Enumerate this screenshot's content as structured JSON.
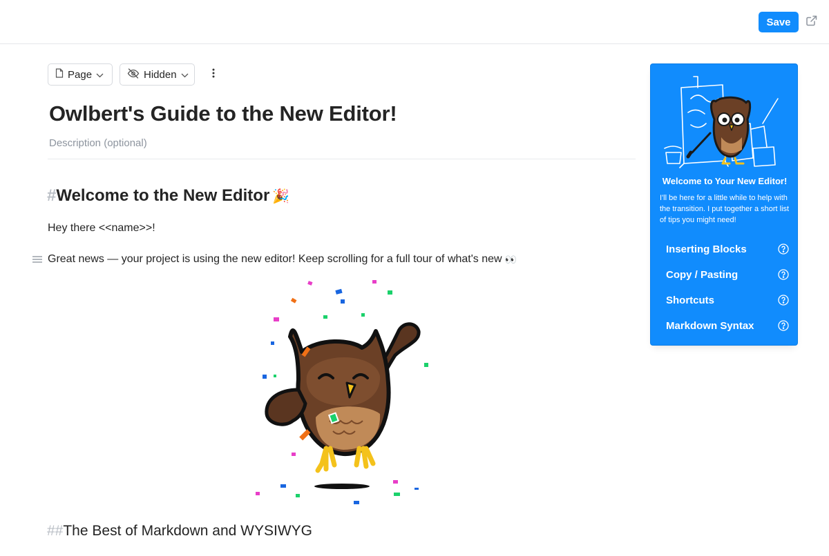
{
  "topbar": {
    "save_label": "Save",
    "external_icon": "external-link-icon"
  },
  "toolbar": {
    "page_label": "Page",
    "hidden_label": "Hidden",
    "more_icon": "more-vertical-icon"
  },
  "document": {
    "title": "Owlbert's Guide to the New Editor!",
    "description_placeholder": "Description (optional)",
    "heading1_hash": "#",
    "heading1_text": "Welcome to the New Editor",
    "heading1_emoji": "🎉",
    "paragraph1": "Hey there <<name>>!",
    "paragraph2": "Great news — your project is using the new editor! Keep scrolling for a full tour of what's new",
    "paragraph2_emoji": "👀",
    "heading2_hash": "##",
    "heading2_text": "The Best of Markdown and WYSIWYG"
  },
  "panel": {
    "heading": "Welcome to Your New Editor!",
    "body": "I'll be here for a little while to help with the transition. I put together a short list of tips you might need!",
    "links": [
      {
        "label": "Inserting Blocks"
      },
      {
        "label": "Copy / Pasting"
      },
      {
        "label": "Shortcuts"
      },
      {
        "label": "Markdown Syntax"
      }
    ]
  },
  "colors": {
    "accent": "#118cfd",
    "text": "#242424",
    "muted": "#8d949e",
    "hash": "#b9bec5"
  }
}
